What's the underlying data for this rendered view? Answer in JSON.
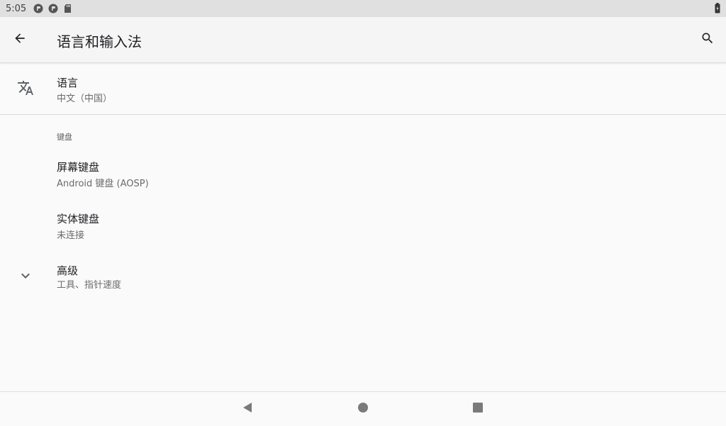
{
  "status_bar": {
    "time": "5:05",
    "icons": [
      "notification-circle-icon",
      "notification-circle-icon",
      "sd-card-icon",
      "battery-icon"
    ]
  },
  "app_bar": {
    "title": "语言和输入法",
    "icons": [
      "back-arrow-icon",
      "search-icon"
    ]
  },
  "preferences": {
    "language": {
      "title": "语言",
      "summary": "中文（中国）",
      "icon": "translate-icon"
    },
    "keyboard_category": "键盘",
    "on_screen_keyboard": {
      "title": "屏幕键盘",
      "summary": "Android 键盘 (AOSP)"
    },
    "physical_keyboard": {
      "title": "实体键盘",
      "summary": "未连接"
    },
    "advanced": {
      "title": "高级",
      "summary": "工具、指针速度",
      "icon": "chevron-down-icon"
    }
  },
  "nav_bar": {
    "icons": [
      "back-triangle-icon",
      "home-circle-icon",
      "recents-square-icon"
    ]
  },
  "colors": {
    "background": "#fafafa",
    "status_bar": "#e0e0e0",
    "app_bar": "#f5f5f5",
    "primary_text": "#202124",
    "secondary_text": "#6b6b6b",
    "nav_icons": "#7a7a7a"
  }
}
